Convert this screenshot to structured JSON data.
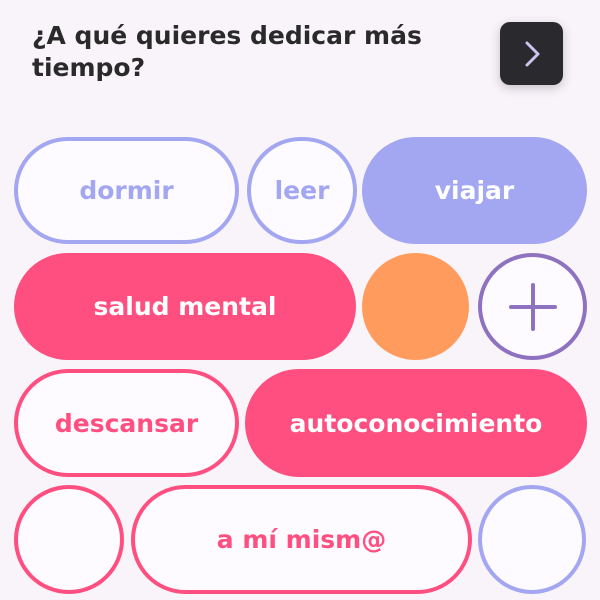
{
  "header": {
    "question": "¿A qué quieres dedicar más tiempo?"
  },
  "next_button": {
    "icon": "chevron-right-icon"
  },
  "options": {
    "dormir": "dormir",
    "leer": "leer",
    "viajar": "viajar",
    "salud_mental": "salud mental",
    "descansar": "descansar",
    "autoconocimiento": "autoconocimiento",
    "a_mi_mism": "a mí mism@"
  },
  "add_button": {
    "icon": "plus-icon"
  },
  "colors": {
    "background": "#f9f4fa",
    "blue": "#a3a6f0",
    "pink": "#ff4f80",
    "orange": "#ff9b5c",
    "purple": "#8e72bf",
    "dark": "#2a2a2e"
  }
}
